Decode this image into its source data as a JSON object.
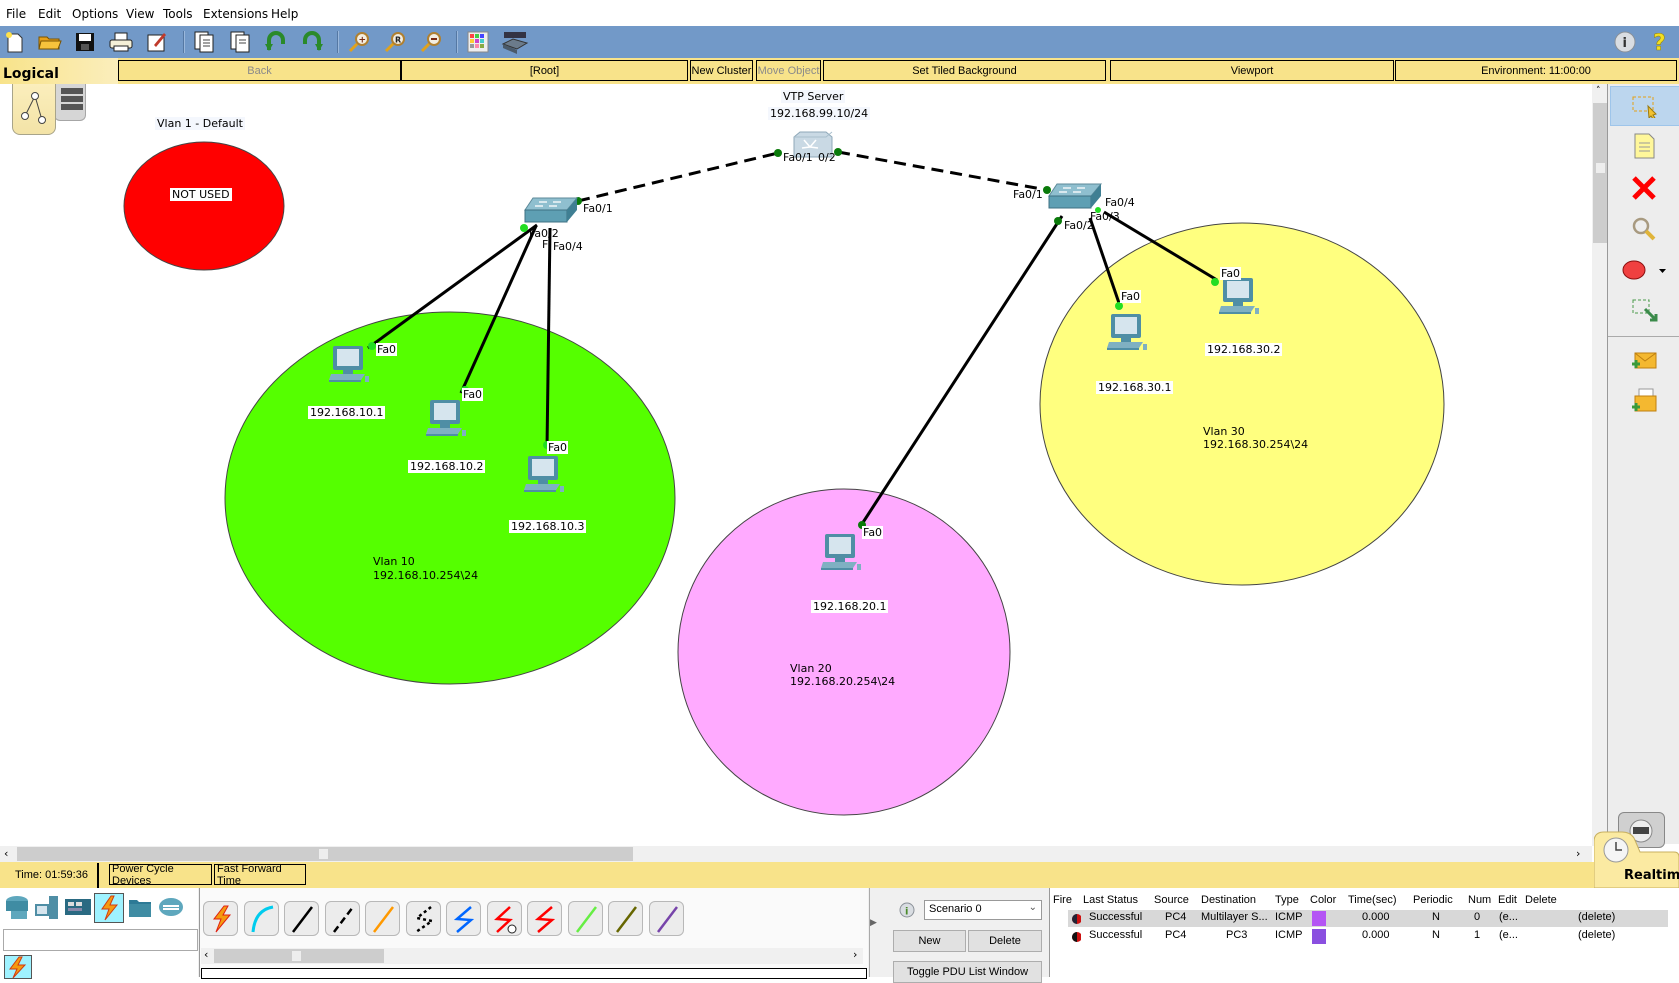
{
  "menu": [
    "File",
    "Edit",
    "Options",
    "View",
    "Tools",
    "Extensions",
    "Help"
  ],
  "toolbar": {
    "icons": [
      "new-file-icon",
      "open-folder-icon",
      "save-icon",
      "print-icon",
      "activity-wizard-icon",
      "copy-icon",
      "paste-icon",
      "undo-icon",
      "redo-icon",
      "zoom-in-icon",
      "zoom-reset-icon",
      "zoom-out-icon",
      "palette-icon",
      "custom-device-icon"
    ],
    "right_icons": [
      "info-icon",
      "help-icon"
    ]
  },
  "nav": {
    "mode": "Logical",
    "back": "Back",
    "root": "[Root]",
    "new_cluster": "New Cluster",
    "move_object": "Move Object",
    "set_tiled_background": "Set Tiled Background",
    "viewport": "Viewport",
    "environment": "Environment: 11:00:00"
  },
  "canvas": {
    "vlan1": {
      "title": "Vlan 1 - Default",
      "note": "NOT USED",
      "color": "#ff0000"
    },
    "vlan10": {
      "name": "Vlan 10",
      "gateway": "192.168.10.254\\24",
      "color": "#55ff00"
    },
    "vlan20": {
      "name": "Vlan 20",
      "gateway": "192.168.20.254\\24",
      "color": "#ffaaff"
    },
    "vlan30": {
      "name": "Vlan 30",
      "gateway": "192.168.30.254\\24",
      "color": "#ffff7f"
    },
    "core": {
      "name": "VTP Server",
      "ip": "192.168.99.10/24",
      "port_left": "Fa0/1",
      "port_right": "0/2"
    },
    "switch_left": {
      "uplink": "Fa0/1",
      "ports": [
        "Fa0/2",
        "F",
        "Fa0/4"
      ]
    },
    "switch_right": {
      "uplink": "Fa0/1",
      "ports": [
        "Fa0/2",
        "Fa0/3",
        "Fa0/4"
      ]
    },
    "pcs": [
      {
        "ip": "192.168.10.1",
        "port": "Fa0"
      },
      {
        "ip": "192.168.10.2",
        "port": "Fa0"
      },
      {
        "ip": "192.168.10.3",
        "port": "Fa0"
      },
      {
        "ip": "192.168.20.1",
        "port": "Fa0"
      },
      {
        "ip": "192.168.30.1",
        "port": "Fa0"
      },
      {
        "ip": "192.168.30.2",
        "port": "Fa0"
      }
    ]
  },
  "right_tools": [
    "select-icon",
    "note-icon",
    "delete-icon",
    "inspect-icon",
    "draw-ellipse-icon",
    "resize-icon",
    "add-simple-pdu-icon",
    "add-complex-pdu-icon"
  ],
  "status": {
    "time": "Time: 01:59:36",
    "power_cycle": "Power Cycle Devices",
    "fast_forward": "Fast Forward Time",
    "mode": "Realtime"
  },
  "device_categories": [
    "network-devices-icon",
    "end-devices-icon",
    "components-icon",
    "connections-icon",
    "misc-icon",
    "multiuser-icon"
  ],
  "connections": [
    "automatic-connection",
    "console-cable",
    "copper-straight-through",
    "copper-cross-over",
    "fiber",
    "phone-cable",
    "coaxial",
    "serial-dce",
    "serial-dte",
    "octal",
    "iot-custom-cable",
    "usb-cable"
  ],
  "connection_colors": [
    "#ff3300",
    "#00ccee",
    "#000000",
    "#000000",
    "#ff9900",
    "#000000",
    "#0066ff",
    "#ff0000",
    "#ff0000",
    "#66ee44",
    "#666600",
    "#7744aa"
  ],
  "scenario": {
    "selected": "Scenario 0",
    "new": "New",
    "delete": "Delete",
    "toggle": "Toggle PDU List Window"
  },
  "pdu": {
    "columns": [
      "Fire",
      "Last Status",
      "Source",
      "Destination",
      "Type",
      "Color",
      "Time(sec)",
      "Periodic",
      "Num",
      "Edit",
      "Delete"
    ],
    "rows": [
      {
        "status": "Successful",
        "source": "PC4",
        "destination": "Multilayer S...",
        "type": "ICMP",
        "color": "#b455f4",
        "time": "0.000",
        "periodic": "N",
        "num": "0",
        "edit": "(e...",
        "delete": "(delete)"
      },
      {
        "status": "Successful",
        "source": "PC4",
        "destination": "PC3",
        "type": "ICMP",
        "color": "#8a4fe0",
        "time": "0.000",
        "periodic": "N",
        "num": "1",
        "edit": "(e...",
        "delete": "(delete)"
      }
    ]
  }
}
